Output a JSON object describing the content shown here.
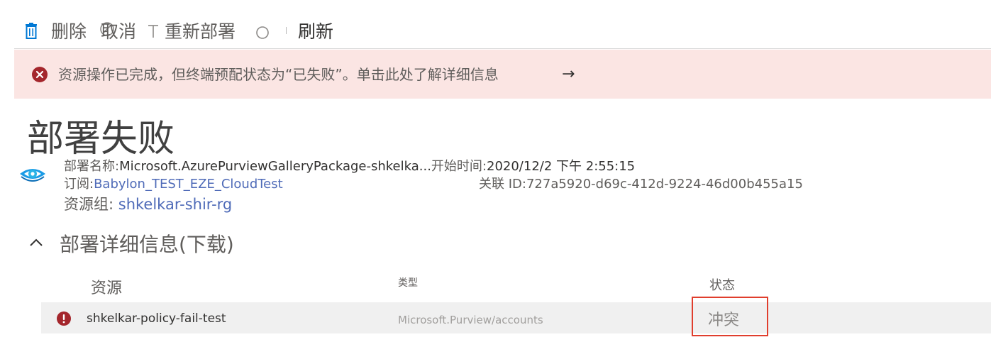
{
  "toolbar": {
    "delete_label": "删除",
    "cancel_label": "取消",
    "redeploy_label": "重新部署",
    "refresh_label": "刷新"
  },
  "banner": {
    "message": "资源操作已完成，但终端预配状态为“已失败”。单击此处了解详细信息",
    "arrow": "→",
    "status_color": "#a4262c"
  },
  "page": {
    "title": "部署失败"
  },
  "deployment": {
    "name_label": "部署名称:",
    "name_value": "Microsoft.AzurePurviewGalleryPackage-shkelka...",
    "start_label": "开始时间:",
    "start_value": "2020/12/2 下午 2:55:15",
    "subscription_label": "订阅:",
    "subscription_value": "Babylon_TEST_EZE_CloudTest",
    "correlation_label": "关联 ID:",
    "correlation_value": "727a5920-d69c-412d-9224-46d00b455a15",
    "resource_group_label": "资源组:",
    "resource_group_value": "shkelkar-shir-rg"
  },
  "details": {
    "title": "部署详细信息(下载)",
    "columns": [
      "资源",
      "类型",
      "状态"
    ],
    "rows": [
      {
        "resource": "shkelkar-policy-fail-test",
        "type": "Microsoft.Purview/accounts",
        "status": "冲突"
      }
    ]
  }
}
